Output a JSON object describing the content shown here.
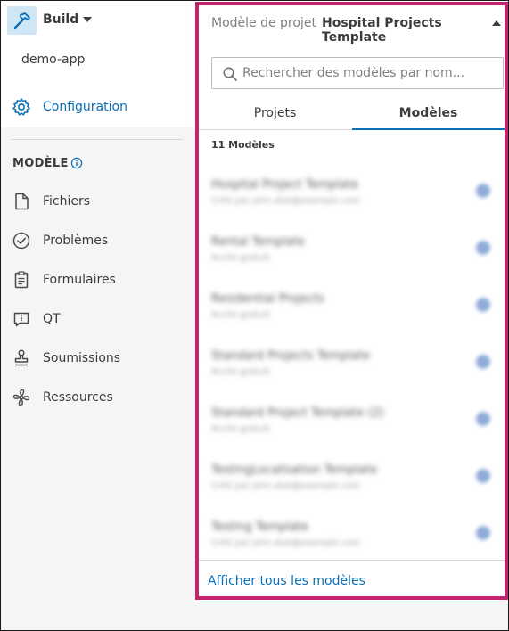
{
  "app": {
    "name": "Build",
    "project": "demo-app"
  },
  "sidebar": {
    "config_label": "Configuration",
    "section_title": "MODÈLE",
    "items": [
      {
        "label": "Fichiers",
        "icon": "file-icon"
      },
      {
        "label": "Problèmes",
        "icon": "check-circle-icon"
      },
      {
        "label": "Formulaires",
        "icon": "clipboard-icon"
      },
      {
        "label": "QT",
        "icon": "speech-info-icon"
      },
      {
        "label": "Soumissions",
        "icon": "stamp-icon"
      },
      {
        "label": "Ressources",
        "icon": "fan-icon"
      }
    ]
  },
  "dropdown": {
    "label": "Modèle de projet",
    "selected": "Hospital Projects Template",
    "search_placeholder": "Rechercher des modèles par nom...",
    "tabs": [
      {
        "label": "Projets",
        "active": false
      },
      {
        "label": "Modèles",
        "active": true
      }
    ],
    "count_label": "11 Modèles",
    "templates": [
      {
        "name": "Hospital Project Template",
        "sub": "Créé par john.doe@example.com"
      },
      {
        "name": "Rental Template",
        "sub": "Accès gratuit"
      },
      {
        "name": "Residential Projects",
        "sub": "Accès gratuit"
      },
      {
        "name": "Standard Projects Template",
        "sub": "Accès gratuit"
      },
      {
        "name": "Standard Project Template (2)",
        "sub": "Accès gratuit"
      },
      {
        "name": "TestingLocalisation Template",
        "sub": "Créé par john.doe@example.com"
      },
      {
        "name": "Testing Template",
        "sub": "Créé par john.doe@example.com"
      }
    ],
    "footer_link": "Afficher tous les modèles"
  },
  "colors": {
    "accent": "#0a6fb7",
    "highlight_border": "#c2246e",
    "sidebar_bg": "#f5f5f5"
  }
}
